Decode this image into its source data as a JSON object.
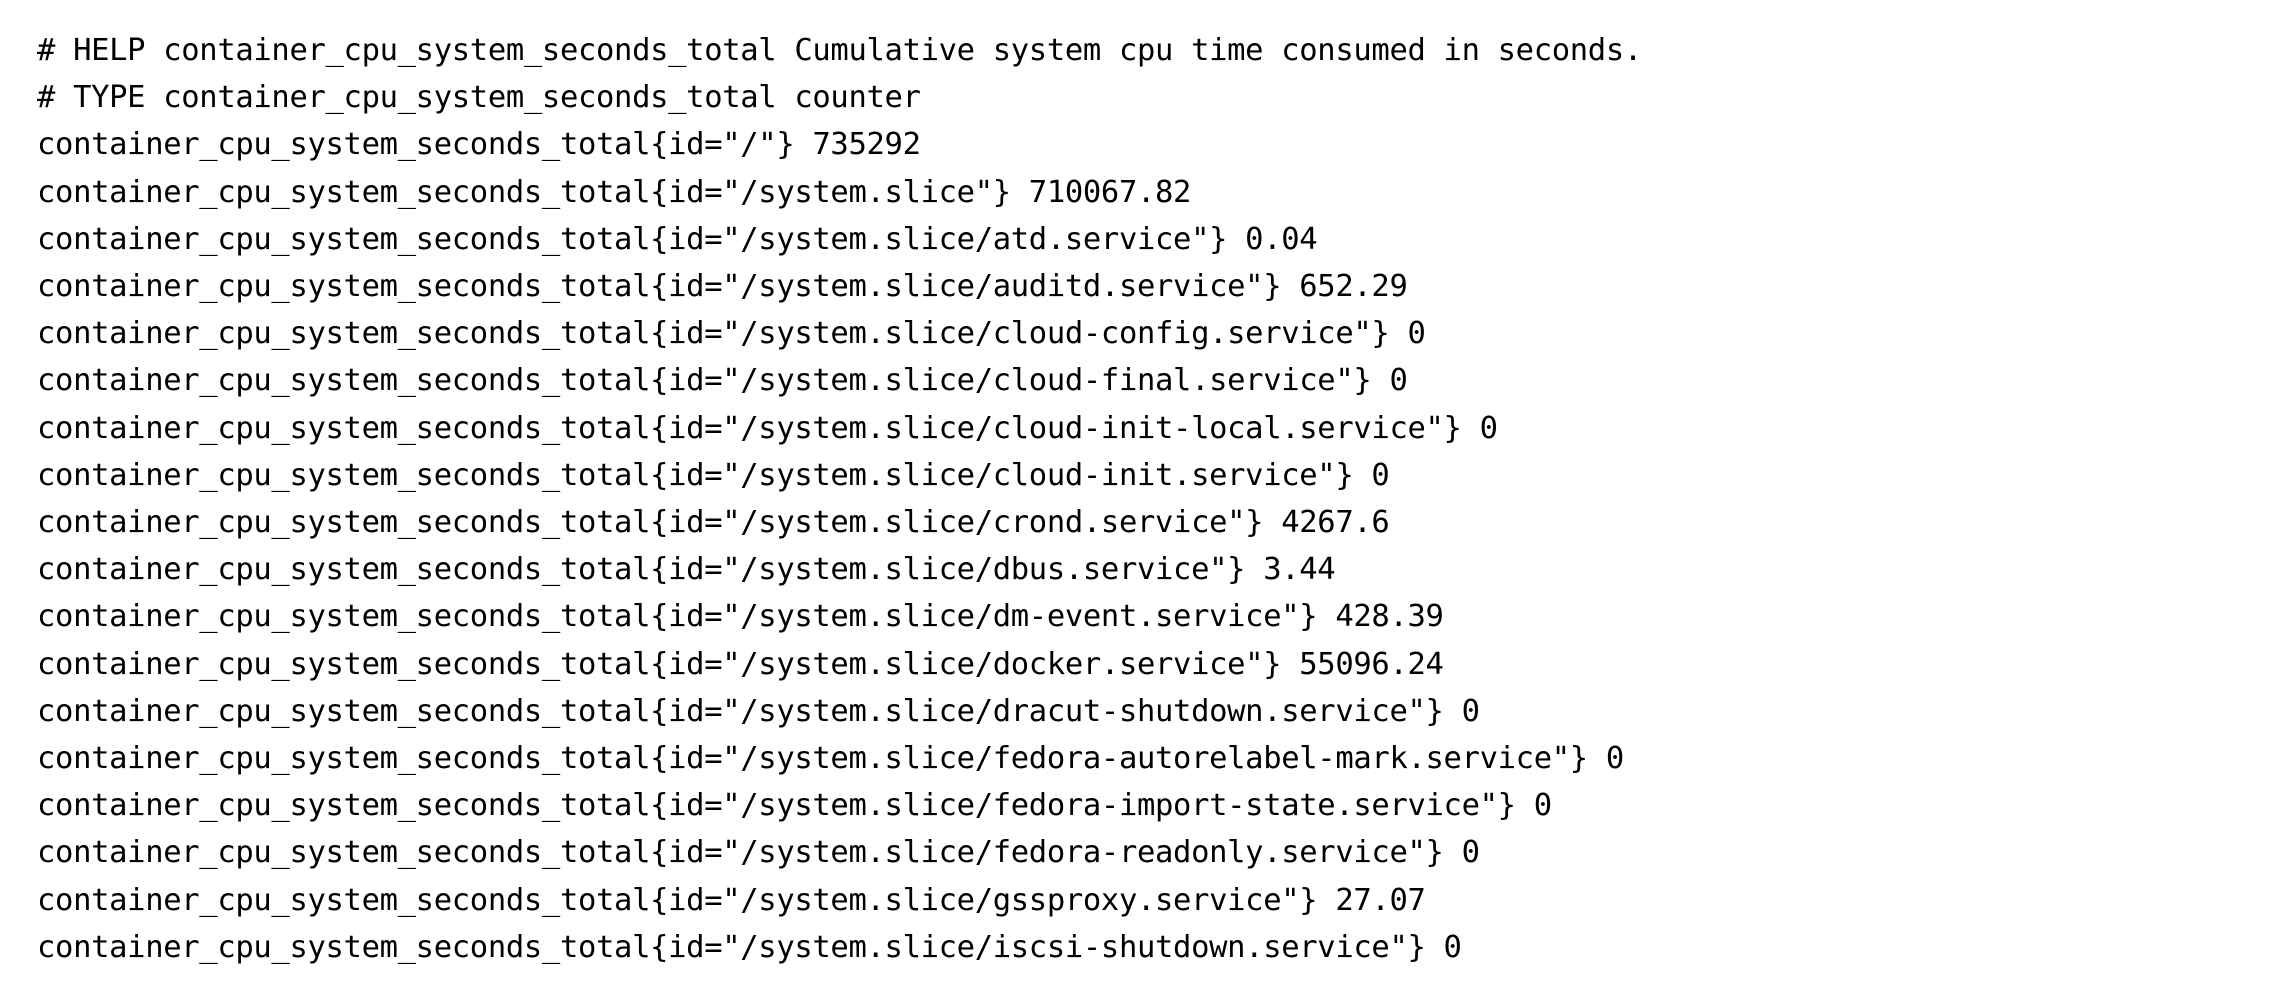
{
  "page": {
    "kind": "prometheus-metrics-text",
    "background_color": "#ffffff",
    "text_color": "#000000",
    "metric_name": "container_cpu_system_seconds_total"
  },
  "metrics": {
    "help_comment": "# HELP container_cpu_system_seconds_total Cumulative system cpu time consumed in seconds.",
    "type_comment": "# TYPE container_cpu_system_seconds_total counter",
    "lines": [
      "container_cpu_system_seconds_total{id=\"/\"} 735292",
      "container_cpu_system_seconds_total{id=\"/system.slice\"} 710067.82",
      "container_cpu_system_seconds_total{id=\"/system.slice/atd.service\"} 0.04",
      "container_cpu_system_seconds_total{id=\"/system.slice/auditd.service\"} 652.29",
      "container_cpu_system_seconds_total{id=\"/system.slice/cloud-config.service\"} 0",
      "container_cpu_system_seconds_total{id=\"/system.slice/cloud-final.service\"} 0",
      "container_cpu_system_seconds_total{id=\"/system.slice/cloud-init-local.service\"} 0",
      "container_cpu_system_seconds_total{id=\"/system.slice/cloud-init.service\"} 0",
      "container_cpu_system_seconds_total{id=\"/system.slice/crond.service\"} 4267.6",
      "container_cpu_system_seconds_total{id=\"/system.slice/dbus.service\"} 3.44",
      "container_cpu_system_seconds_total{id=\"/system.slice/dm-event.service\"} 428.39",
      "container_cpu_system_seconds_total{id=\"/system.slice/docker.service\"} 55096.24",
      "container_cpu_system_seconds_total{id=\"/system.slice/dracut-shutdown.service\"} 0",
      "container_cpu_system_seconds_total{id=\"/system.slice/fedora-autorelabel-mark.service\"} 0",
      "container_cpu_system_seconds_total{id=\"/system.slice/fedora-import-state.service\"} 0",
      "container_cpu_system_seconds_total{id=\"/system.slice/fedora-readonly.service\"} 0",
      "container_cpu_system_seconds_total{id=\"/system.slice/gssproxy.service\"} 27.07",
      "container_cpu_system_seconds_total{id=\"/system.slice/iscsi-shutdown.service\"} 0"
    ],
    "samples": [
      {
        "id": "/",
        "value": "735292"
      },
      {
        "id": "/system.slice",
        "value": "710067.82"
      },
      {
        "id": "/system.slice/atd.service",
        "value": "0.04"
      },
      {
        "id": "/system.slice/auditd.service",
        "value": "652.29"
      },
      {
        "id": "/system.slice/cloud-config.service",
        "value": "0"
      },
      {
        "id": "/system.slice/cloud-final.service",
        "value": "0"
      },
      {
        "id": "/system.slice/cloud-init-local.service",
        "value": "0"
      },
      {
        "id": "/system.slice/cloud-init.service",
        "value": "0"
      },
      {
        "id": "/system.slice/crond.service",
        "value": "4267.6"
      },
      {
        "id": "/system.slice/dbus.service",
        "value": "3.44"
      },
      {
        "id": "/system.slice/dm-event.service",
        "value": "428.39"
      },
      {
        "id": "/system.slice/docker.service",
        "value": "55096.24"
      },
      {
        "id": "/system.slice/dracut-shutdown.service",
        "value": "0"
      },
      {
        "id": "/system.slice/fedora-autorelabel-mark.service",
        "value": "0"
      },
      {
        "id": "/system.slice/fedora-import-state.service",
        "value": "0"
      },
      {
        "id": "/system.slice/fedora-readonly.service",
        "value": "0"
      },
      {
        "id": "/system.slice/gssproxy.service",
        "value": "27.07"
      },
      {
        "id": "/system.slice/iscsi-shutdown.service",
        "value": "0"
      }
    ]
  }
}
